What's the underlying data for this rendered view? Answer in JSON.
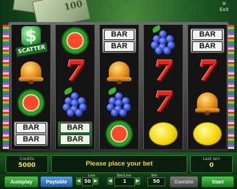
{
  "top": {
    "exit_icon": "close-icon",
    "exit_label": "Exit",
    "banknote_text": "100"
  },
  "reels": [
    [
      "scatter",
      "bell",
      "melon",
      "barbar"
    ],
    [
      "melon",
      "seven",
      "grapes",
      "barbar-green"
    ],
    [
      "barbar",
      "bell",
      "grapes",
      "melon"
    ],
    [
      "grapes",
      "seven",
      "seven",
      "lemon"
    ],
    [
      "barbar",
      "seven",
      "bell",
      "lemon"
    ]
  ],
  "symbols": {
    "bar_text": "BAR",
    "seven_text": "7",
    "scatter_symbol": "$",
    "scatter_label": "SCATTER"
  },
  "info": {
    "credits_label": "Credits",
    "credits_value": "5000",
    "message": "Please place your bet",
    "lastwin_label": "Last win",
    "lastwin_value": "0"
  },
  "controls": {
    "autoplay": "Autoplay",
    "paytable": "Paytable",
    "line_label": "Line",
    "line_value": "50",
    "betline_label": "Bet/Line",
    "betline_value": "1",
    "bet_label": "Bet",
    "bet_value": "50",
    "gamble": "Gamble",
    "start": "Start",
    "arrow_left": "◀",
    "arrow_right": "▶"
  }
}
